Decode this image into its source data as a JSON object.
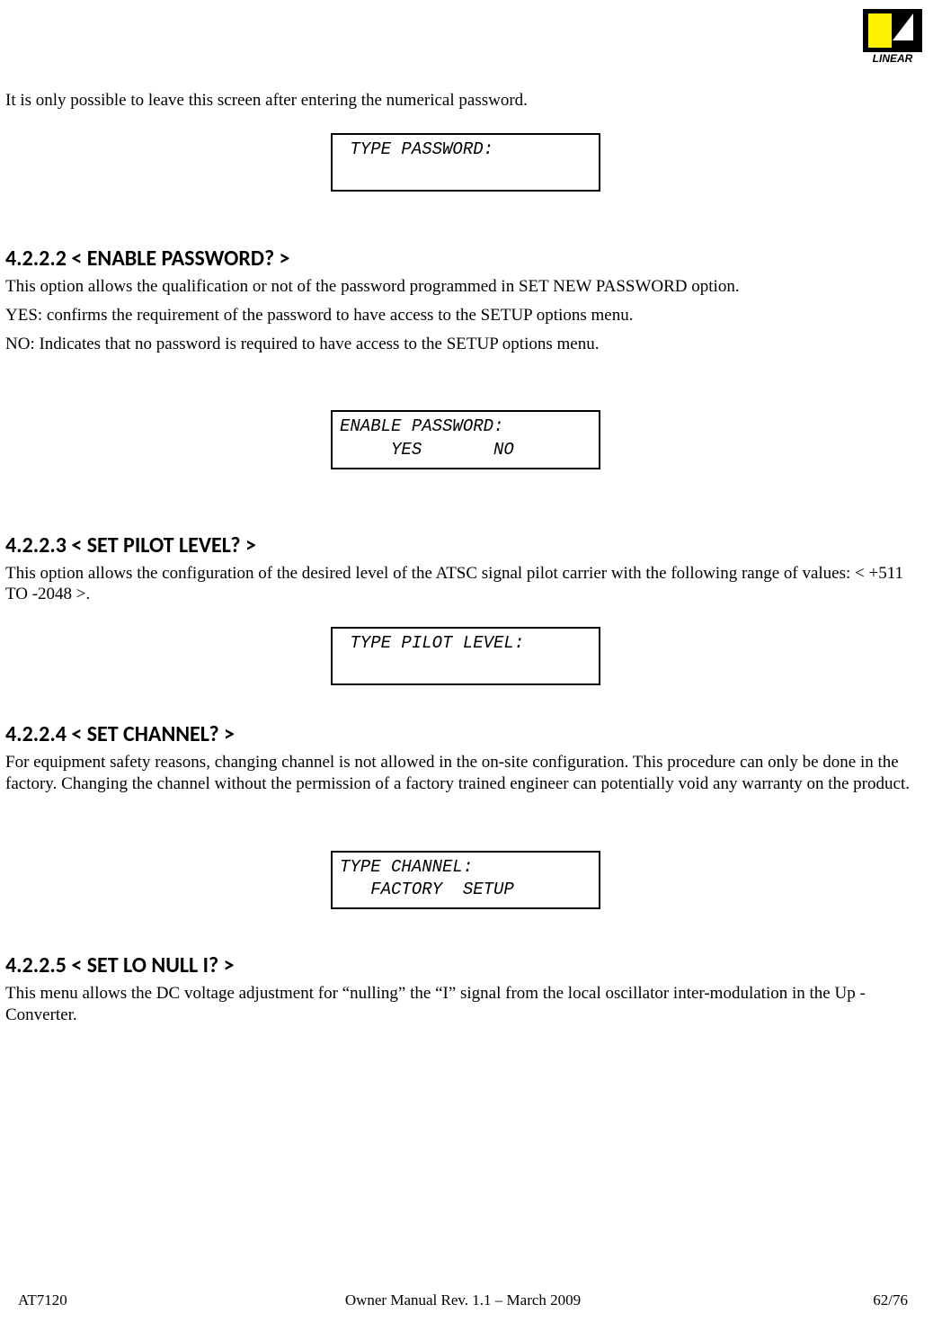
{
  "logo": {
    "brand": "LINEAR"
  },
  "intro": {
    "p1": "It is only possible to leave this screen after entering the numerical password."
  },
  "boxes": {
    "typePassword": {
      "line1": " TYPE PASSWORD:"
    },
    "enablePassword": {
      "line1": "ENABLE PASSWORD:",
      "line2": "     YES       NO"
    },
    "typePilotLevel": {
      "line1": " TYPE PILOT LEVEL:"
    },
    "typeChannel": {
      "line1": "TYPE CHANNEL:",
      "line2": "   FACTORY  SETUP"
    }
  },
  "sections": {
    "s4222": {
      "heading": "4.2.2.2 < ENABLE PASSWORD? >",
      "p1": "This option allows the qualification or not of the password programmed in SET NEW PASSWORD option.",
      "p2": "YES: confirms the requirement of the password to have access to the SETUP options menu.",
      "p3": "NO:  Indicates that no password is required to have access to the SETUP options menu."
    },
    "s4223": {
      "heading": "4.2.2.3 < SET PILOT LEVEL? >",
      "p1": "This option allows the configuration of the desired level of the ATSC signal pilot carrier with the following range of values: < +511 TO -2048 >."
    },
    "s4224": {
      "heading": "4.2.2.4 < SET CHANNEL? >",
      "p1": "For equipment safety reasons, changing channel is not allowed in the on-site configuration. This procedure can only be done in the factory. Changing the channel without the permission of a factory trained engineer can potentially void any warranty on the product."
    },
    "s4225": {
      "heading": "4.2.2.5 < SET LO NULL I? >",
      "p1": "This menu allows the DC voltage adjustment for “nulling” the “I” signal from the local oscillator inter-modulation in the Up -Converter."
    }
  },
  "footer": {
    "left": "AT7120",
    "center": "Owner Manual Rev. 1.1 – March 2009",
    "right": "62/76"
  }
}
